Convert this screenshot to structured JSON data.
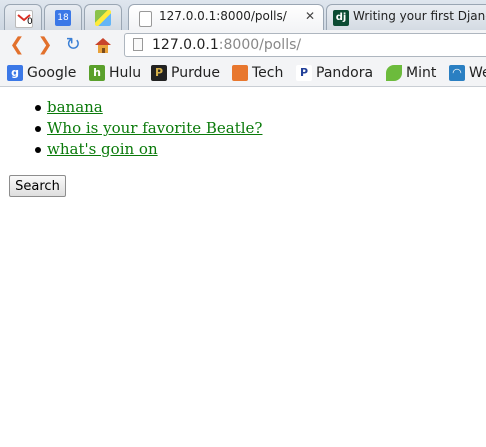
{
  "browser": {
    "tabs": [
      {
        "icon": "gmail-icon",
        "title": "",
        "badge": "0"
      },
      {
        "icon": "calendar-icon",
        "title": "",
        "badge": "18"
      },
      {
        "icon": "maps-icon",
        "title": ""
      },
      {
        "icon": "page-icon",
        "title": "127.0.0.1:8000/polls/",
        "active": true
      },
      {
        "icon": "django-icon",
        "title": "Writing your first Django"
      }
    ],
    "close_glyph": "✕",
    "address": {
      "host": "127.0.0.1",
      "path": ":8000/polls/"
    },
    "bookmarks": [
      {
        "label": "Google",
        "icon": "google-icon",
        "color": "#3b78e7"
      },
      {
        "label": "Hulu",
        "icon": "hulu-icon",
        "color": "#5aa02c"
      },
      {
        "label": "Purdue",
        "icon": "purdue-icon",
        "color": "#b08d2a"
      },
      {
        "label": "Tech",
        "icon": "folder-icon",
        "color": "#e8772e"
      },
      {
        "label": "Pandora",
        "icon": "pandora-icon",
        "color": "#224099"
      },
      {
        "label": "Mint",
        "icon": "mint-icon",
        "color": "#6cbb3c"
      },
      {
        "label": "We",
        "icon": "weather-icon",
        "color": "#2a7fc2"
      }
    ]
  },
  "page": {
    "polls": [
      "banana",
      "Who is your favorite Beatle?",
      "what's goin on"
    ],
    "search_label": "Search"
  }
}
